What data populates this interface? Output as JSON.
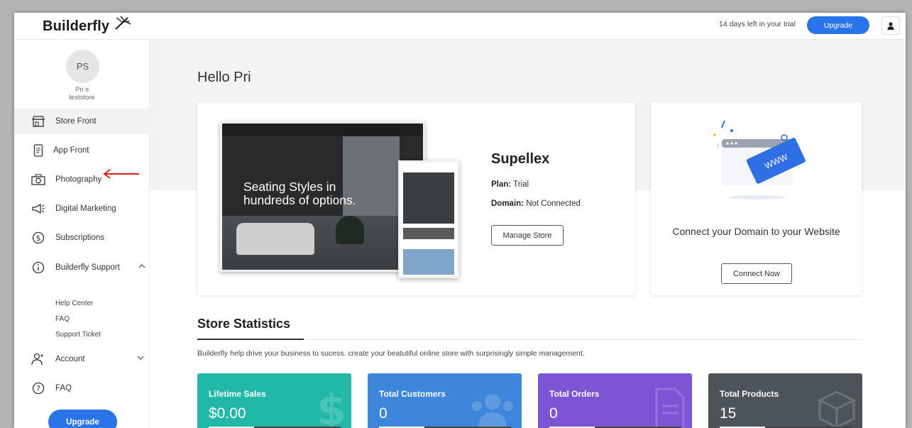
{
  "app": {
    "logo_text": "Builderfly"
  },
  "topbar": {
    "trial_text": "14 days left in your trial",
    "upgrade_label": "Upgrade"
  },
  "sidebar": {
    "avatar_initials": "PS",
    "user_name": "Pri s",
    "store_name": "teststore",
    "items": [
      {
        "label": "Store Front",
        "icon": "storefront-icon",
        "active": true
      },
      {
        "label": "App Front",
        "icon": "mobile-app-icon"
      },
      {
        "label": "Photography",
        "icon": "camera-icon"
      },
      {
        "label": "Digital Marketing",
        "icon": "megaphone-icon"
      },
      {
        "label": "Subscriptions",
        "icon": "dollar-circle-icon"
      },
      {
        "label": "Builderfly Support",
        "icon": "info-icon",
        "expanded": true
      },
      {
        "label": "Account",
        "icon": "account-icon"
      },
      {
        "label": "FAQ",
        "icon": "question-icon"
      }
    ],
    "support_sub": [
      "Help Center",
      "FAQ",
      "Support Ticket"
    ],
    "upgrade_label": "Upgrade"
  },
  "main": {
    "greeting": "Hello Pri",
    "store": {
      "name": "Supellex",
      "plan_label": "Plan:",
      "plan_value": "Trial",
      "domain_label": "Domain:",
      "domain_value": "Not Connected",
      "manage_label": "Manage Store",
      "preview_hero": "Seating Styles in hundreds of options."
    },
    "domain_card": {
      "text": "Connect your Domain to your Website",
      "button_label": "Connect Now",
      "badge_text": "WWW"
    },
    "stats": {
      "title": "Store Statistics",
      "description": "Builderfly help drive your business to sucess. create your beatutiful online store with surprisingly simple management.",
      "cards": [
        {
          "label": "Lifetime Sales",
          "value": "$0.00",
          "color": "#22b8a7"
        },
        {
          "label": "Total Customers",
          "value": "0",
          "color": "#3e86dc"
        },
        {
          "label": "Total Orders",
          "value": "0",
          "color": "#7c55d4"
        },
        {
          "label": "Total Products",
          "value": "15",
          "color": "#4c5359"
        }
      ]
    }
  },
  "colors": {
    "accent": "#2874e8",
    "annotation_arrow": "#e0201b"
  }
}
